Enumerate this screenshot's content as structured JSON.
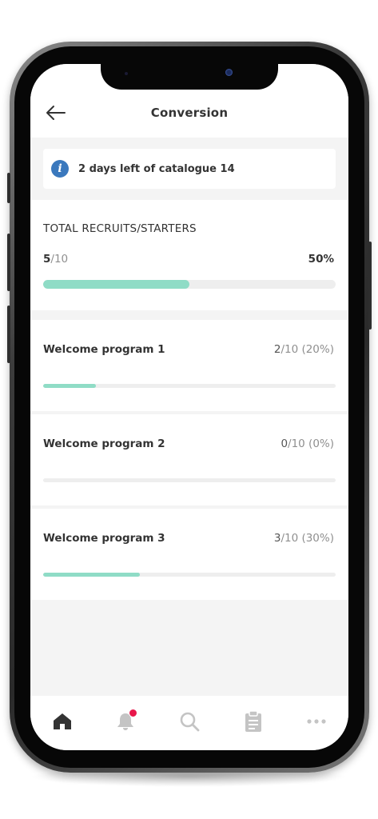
{
  "header": {
    "title": "Conversion",
    "back_icon": "arrow-left-icon"
  },
  "info": {
    "icon": "info-icon",
    "icon_glyph": "i",
    "text": "2 days left of catalogue 14"
  },
  "total": {
    "title": "TOTAL RECRUITS/STARTERS",
    "count_main": "5",
    "count_rest": "/10",
    "percent": "50%",
    "progress": 0.5
  },
  "programs": [
    {
      "name": "Welcome program 1",
      "stat_main": "2",
      "stat_rest": "/10 (20%)",
      "progress": 0.18
    },
    {
      "name": "Welcome program 2",
      "stat_main": "0",
      "stat_rest": "/10 (0%)",
      "progress": 0.0
    },
    {
      "name": "Welcome program 3",
      "stat_main": "3",
      "stat_rest": "/10 (30%)",
      "progress": 0.33
    }
  ],
  "tabs": [
    {
      "icon": "home-icon",
      "active": true
    },
    {
      "icon": "bell-icon",
      "badge": true
    },
    {
      "icon": "search-icon"
    },
    {
      "icon": "clipboard-icon"
    },
    {
      "icon": "more-icon"
    }
  ],
  "colors": {
    "accent": "#8fdcc6",
    "info": "#3a78bd",
    "badge": "#e8174a",
    "text": "#333333",
    "muted": "#8f8f8f",
    "track": "#eeeeee",
    "background": "#f4f4f4"
  }
}
